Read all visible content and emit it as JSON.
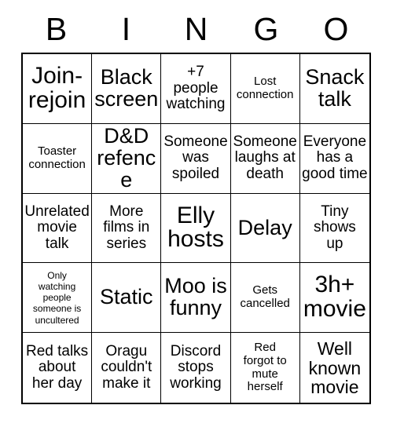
{
  "card": {
    "title": "BINGO",
    "header_letters": [
      "B",
      "I",
      "N",
      "G",
      "O"
    ],
    "grid_size": "5x5",
    "colors": {
      "background": "#ffffff",
      "text": "#000000",
      "border": "#000000"
    },
    "rows": [
      [
        {
          "text": "Join-\nrejoin",
          "size": "xxl"
        },
        {
          "text": "Black\nscreen",
          "size": "xl"
        },
        {
          "text": "+7\npeople\nwatching",
          "size": "m"
        },
        {
          "text": "Lost\nconnection",
          "size": "s"
        },
        {
          "text": "Snack\ntalk",
          "size": "xl"
        }
      ],
      [
        {
          "text": "Toaster\nconnection",
          "size": "s"
        },
        {
          "text": "D&D\nrefence",
          "size": "xl"
        },
        {
          "text": "Someone\nwas\nspoiled",
          "size": "m"
        },
        {
          "text": "Someone\nlaughs at\ndeath",
          "size": "m"
        },
        {
          "text": "Everyone\nhas a\ngood time",
          "size": "m"
        }
      ],
      [
        {
          "text": "Unrelated\nmovie\ntalk",
          "size": "m"
        },
        {
          "text": "More\nfilms in\nseries",
          "size": "m"
        },
        {
          "text": "Elly\nhosts",
          "size": "xxl"
        },
        {
          "text": "Delay",
          "size": "xl"
        },
        {
          "text": "Tiny\nshows\nup",
          "size": "m"
        }
      ],
      [
        {
          "text": "Only\nwatching\npeople\nsomeone is\nuncultered",
          "size": "xs"
        },
        {
          "text": "Static",
          "size": "xl"
        },
        {
          "text": "Moo is\nfunny",
          "size": "xl"
        },
        {
          "text": "Gets\ncancelled",
          "size": "s"
        },
        {
          "text": "3h+\nmovie",
          "size": "xxl"
        }
      ],
      [
        {
          "text": "Red talks\nabout\nher day",
          "size": "m"
        },
        {
          "text": "Oragu\ncouldn't\nmake it",
          "size": "m"
        },
        {
          "text": "Discord\nstops\nworking",
          "size": "m"
        },
        {
          "text": "Red\nforgot to\nmute\nherself",
          "size": "s"
        },
        {
          "text": "Well\nknown\nmovie",
          "size": "l"
        }
      ]
    ]
  }
}
